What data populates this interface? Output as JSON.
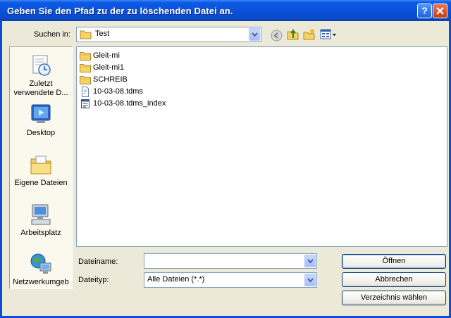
{
  "window": {
    "title": "Geben Sie den Pfad zu der zu löschenden Datei an."
  },
  "toolbar": {
    "lookin_label": "Suchen in:",
    "lookin_value": "Test"
  },
  "places": [
    {
      "label": "Zuletzt verwendete D...",
      "icon": "recent-documents-icon"
    },
    {
      "label": "Desktop",
      "icon": "desktop-icon"
    },
    {
      "label": "Eigene Dateien",
      "icon": "my-documents-icon"
    },
    {
      "label": "Arbeitsplatz",
      "icon": "my-computer-icon"
    },
    {
      "label": "Netzwerkumgeb",
      "icon": "network-icon"
    }
  ],
  "files": [
    {
      "name": "Gleit-mi",
      "icon": "folder-icon"
    },
    {
      "name": "Gleit-mi1",
      "icon": "folder-icon"
    },
    {
      "name": "SCHREIB",
      "icon": "folder-icon"
    },
    {
      "name": "10-03-08.tdms",
      "icon": "document-icon"
    },
    {
      "name": "10-03-08.tdms_index",
      "icon": "index-file-icon"
    }
  ],
  "form": {
    "filename_label": "Dateiname:",
    "filename_value": "",
    "filetype_label": "Dateityp:",
    "filetype_value": "Alle Dateien (*.*)"
  },
  "buttons": {
    "open": "Öffnen",
    "cancel": "Abbrechen",
    "select_dir": "Verzeichnis wählen"
  },
  "colors": {
    "titlebar": "#0a52d9",
    "dialog_bg": "#ece9d8",
    "folder": "#f5d36a"
  }
}
